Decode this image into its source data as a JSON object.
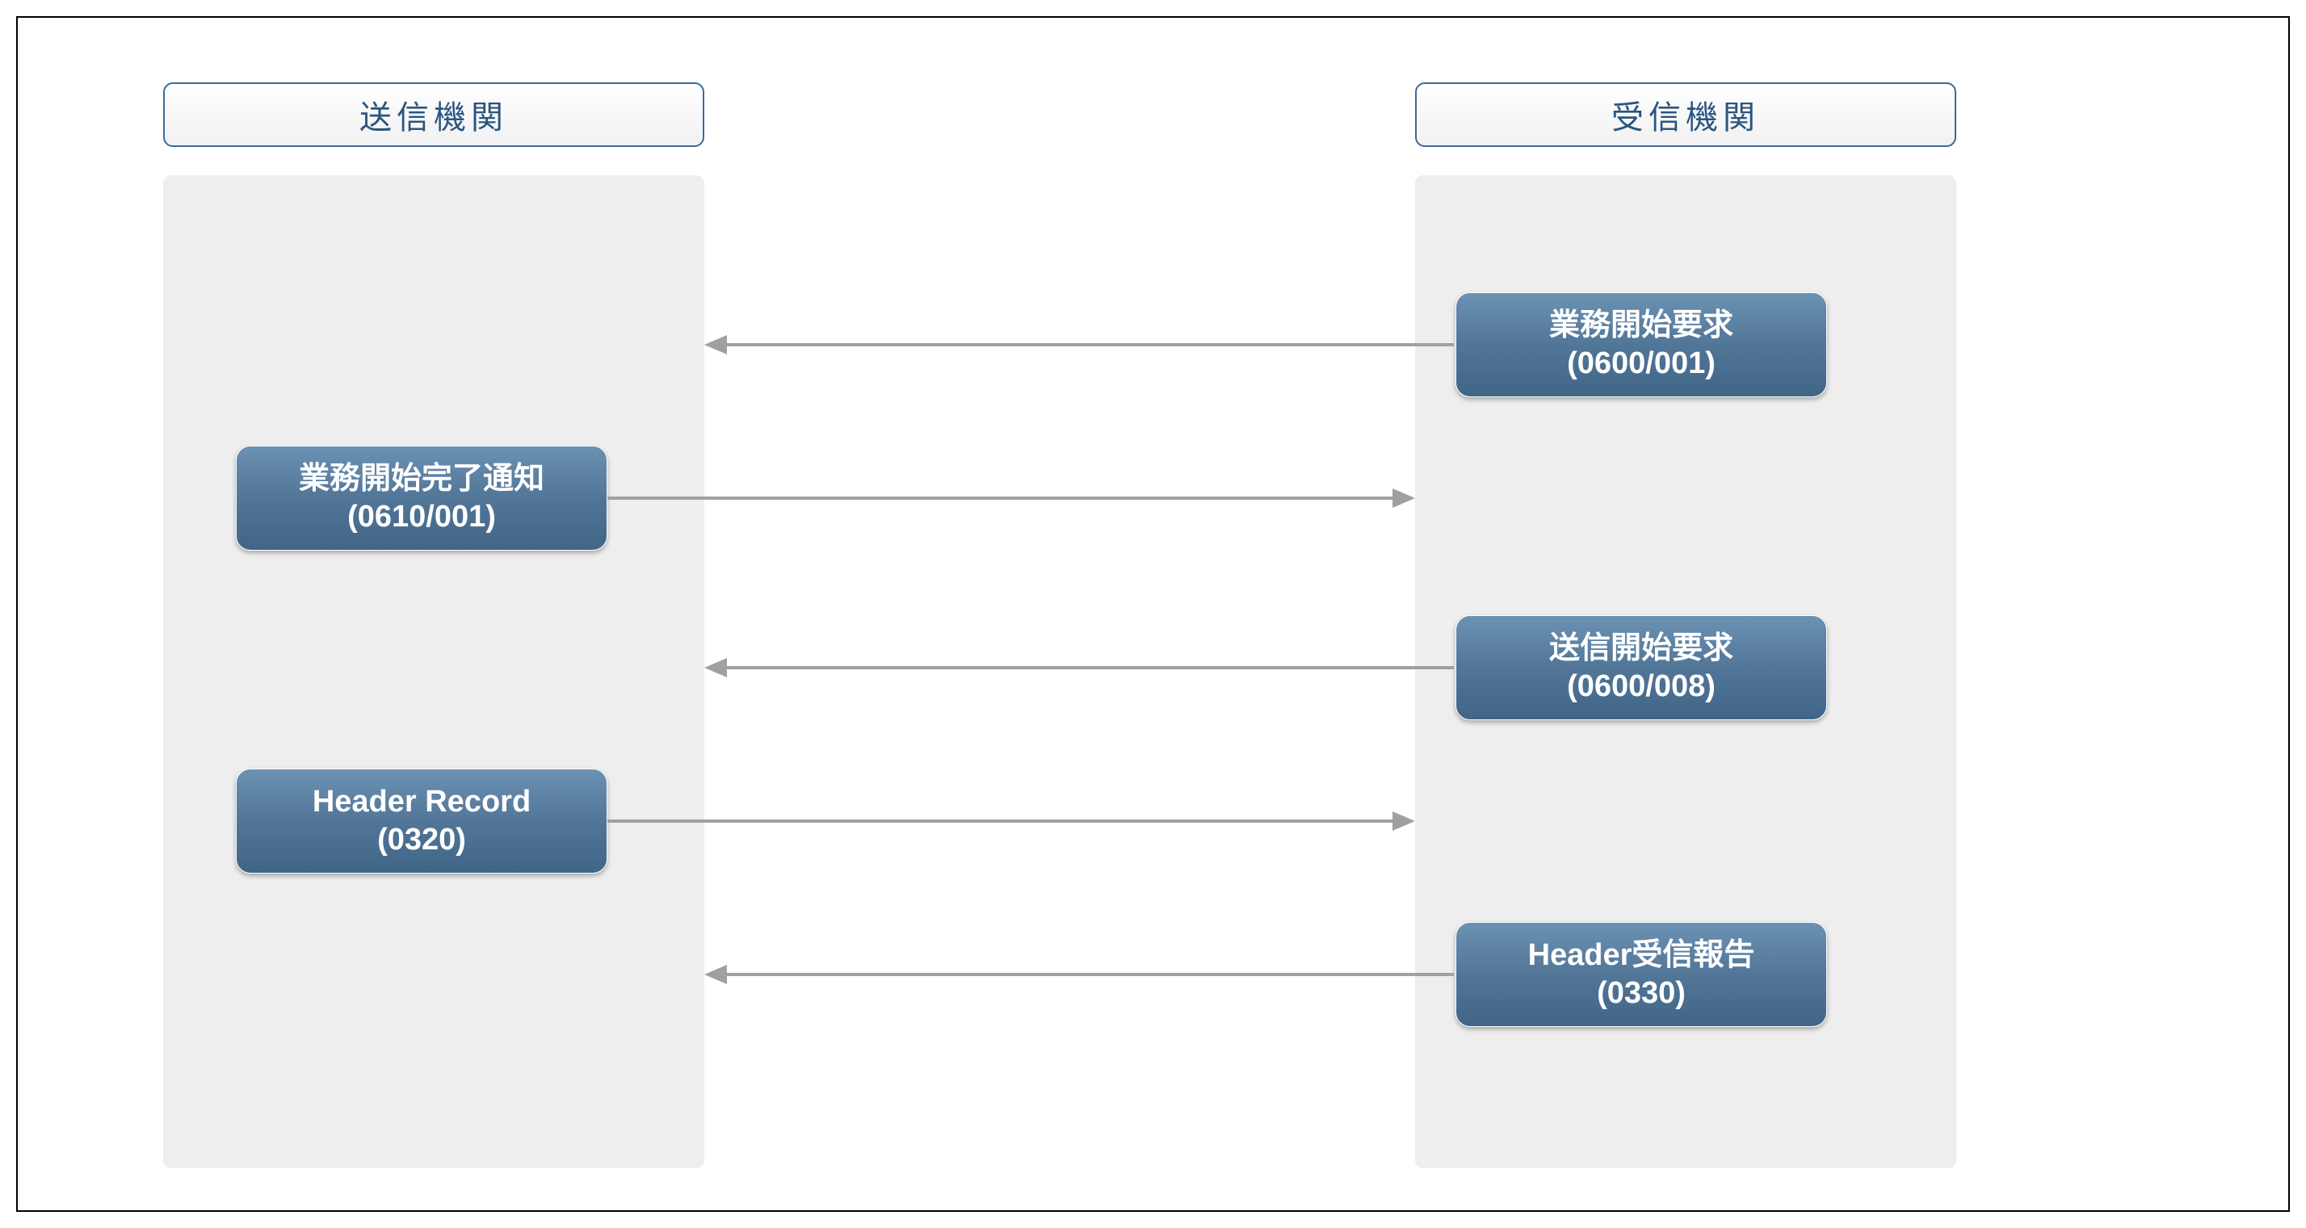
{
  "left_lane": {
    "title": "送信機関"
  },
  "right_lane": {
    "title": "受信機関"
  },
  "messages": {
    "m1": {
      "line1": "業務開始要求",
      "line2": "(0600/001)"
    },
    "m2": {
      "line1": "業務開始完了通知",
      "line2": "(0610/001)"
    },
    "m3": {
      "line1": "送信開始要求",
      "line2": "(0600/008)"
    },
    "m4": {
      "line1": "Header Record",
      "line2": "(0320)"
    },
    "m5": {
      "line1": "Header受信報告",
      "line2": "(0330)"
    }
  }
}
